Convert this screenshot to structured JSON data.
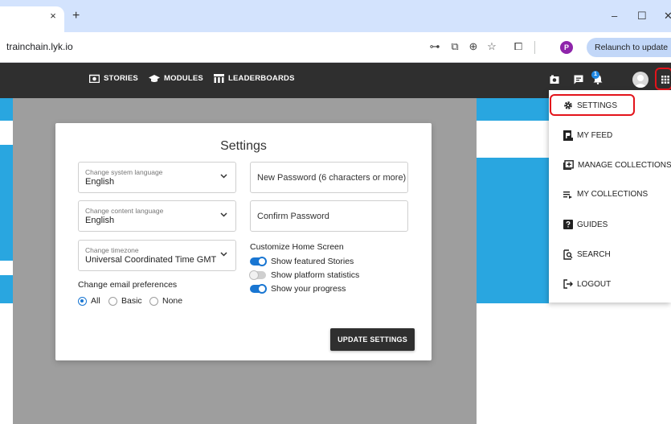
{
  "browser": {
    "tab_close": "×",
    "new_tab": "+",
    "window_controls": {
      "minimize": "–",
      "maximize": "☐",
      "close": "✕"
    },
    "url": "trainchain.lyk.io",
    "toolbar_icons": [
      "password-key-icon",
      "share-icon",
      "zoom-icon",
      "bookmark-star-icon",
      "extensions-icon"
    ],
    "profile_initial": "P",
    "relaunch_label": "Relaunch to update"
  },
  "appbar": {
    "nav": [
      {
        "label": "STORIES",
        "icon": "camera-icon"
      },
      {
        "label": "MODULES",
        "icon": "graduation-cap-icon"
      },
      {
        "label": "LEADERBOARDS",
        "icon": "leaderboard-icon"
      }
    ],
    "notification_count": "1"
  },
  "settings": {
    "title": "Settings",
    "system_language": {
      "label": "Change system language",
      "value": "English"
    },
    "content_language": {
      "label": "Change content language",
      "value": "English"
    },
    "timezone": {
      "label": "Change timezone",
      "value": "Universal Coordinated Time GMT"
    },
    "new_password_placeholder": "New Password (6 characters or more)",
    "confirm_password_placeholder": "Confirm Password",
    "email_prefs": {
      "label": "Change email preferences",
      "options": [
        "All",
        "Basic",
        "None"
      ],
      "selected": "All"
    },
    "home_screen": {
      "label": "Customize Home Screen",
      "toggles": [
        {
          "label": "Show featured Stories",
          "on": true
        },
        {
          "label": "Show platform statistics",
          "on": false
        },
        {
          "label": "Show your progress",
          "on": true
        }
      ]
    },
    "update_button": "UPDATE SETTINGS"
  },
  "menu": {
    "items": [
      {
        "label": "SETTINGS",
        "icon": "gear-icon"
      },
      {
        "label": "MY FEED",
        "icon": "feed-icon"
      },
      {
        "label": "MANAGE COLLECTIONS",
        "icon": "add-collection-icon"
      },
      {
        "label": "MY COLLECTIONS",
        "icon": "playlist-icon"
      },
      {
        "label": "GUIDES",
        "icon": "help-icon"
      },
      {
        "label": "SEARCH",
        "icon": "search-doc-icon"
      },
      {
        "label": "LOGOUT",
        "icon": "logout-icon"
      }
    ]
  },
  "colors": {
    "accent": "#1976d2",
    "appbar": "#2f2f2f",
    "highlight": "#e3141b",
    "page_blue": "#29a6e0",
    "overlay": "#9e9e9e"
  }
}
